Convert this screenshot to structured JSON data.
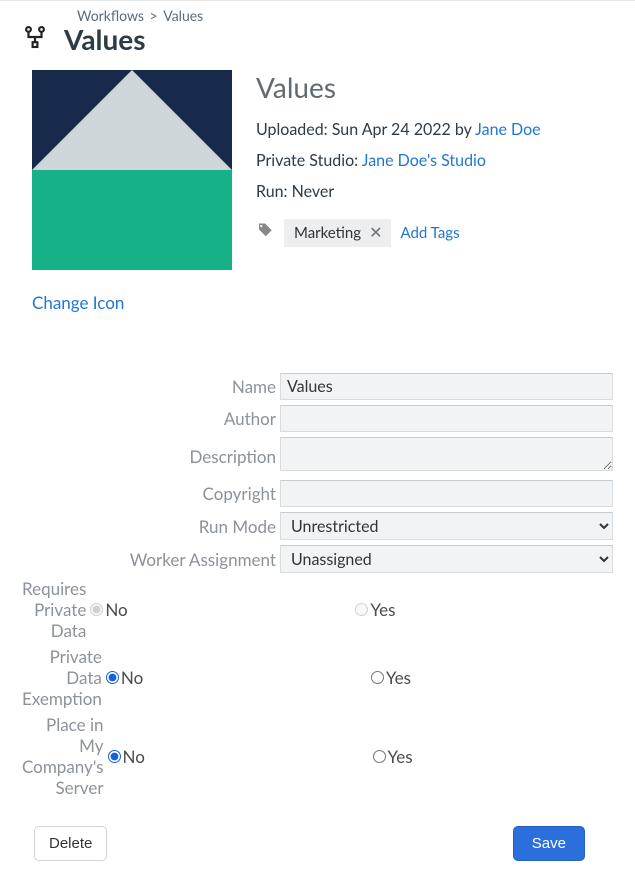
{
  "breadcrumb": {
    "root": "Workflows",
    "sep": ">",
    "current": "Values"
  },
  "page_title": "Values",
  "summary": {
    "title": "Values",
    "uploaded_prefix": "Uploaded: ",
    "uploaded_date": "Sun Apr 24 2022",
    "uploaded_by_word": " by ",
    "uploader": "Jane Doe",
    "studio_prefix": "Private Studio: ",
    "studio_name": "Jane Doe's Studio",
    "run_line": "Run: Never",
    "tag": "Marketing",
    "add_tags": "Add Tags"
  },
  "change_icon": "Change Icon",
  "form": {
    "labels": {
      "name": "Name",
      "author": "Author",
      "description": "Description",
      "copyright": "Copyright",
      "run_mode": "Run Mode",
      "worker": "Worker Assignment",
      "req_private": "Requires Private Data",
      "exemption": "Private Data Exemption",
      "place": "Place in My Company's Server"
    },
    "values": {
      "name": "Values",
      "author": "",
      "description": "",
      "copyright": "",
      "run_mode_selected": "Unrestricted",
      "worker_selected": "Unassigned"
    },
    "options": {
      "no": "No",
      "yes": "Yes"
    }
  },
  "actions": {
    "delete": "Delete",
    "save": "Save"
  }
}
